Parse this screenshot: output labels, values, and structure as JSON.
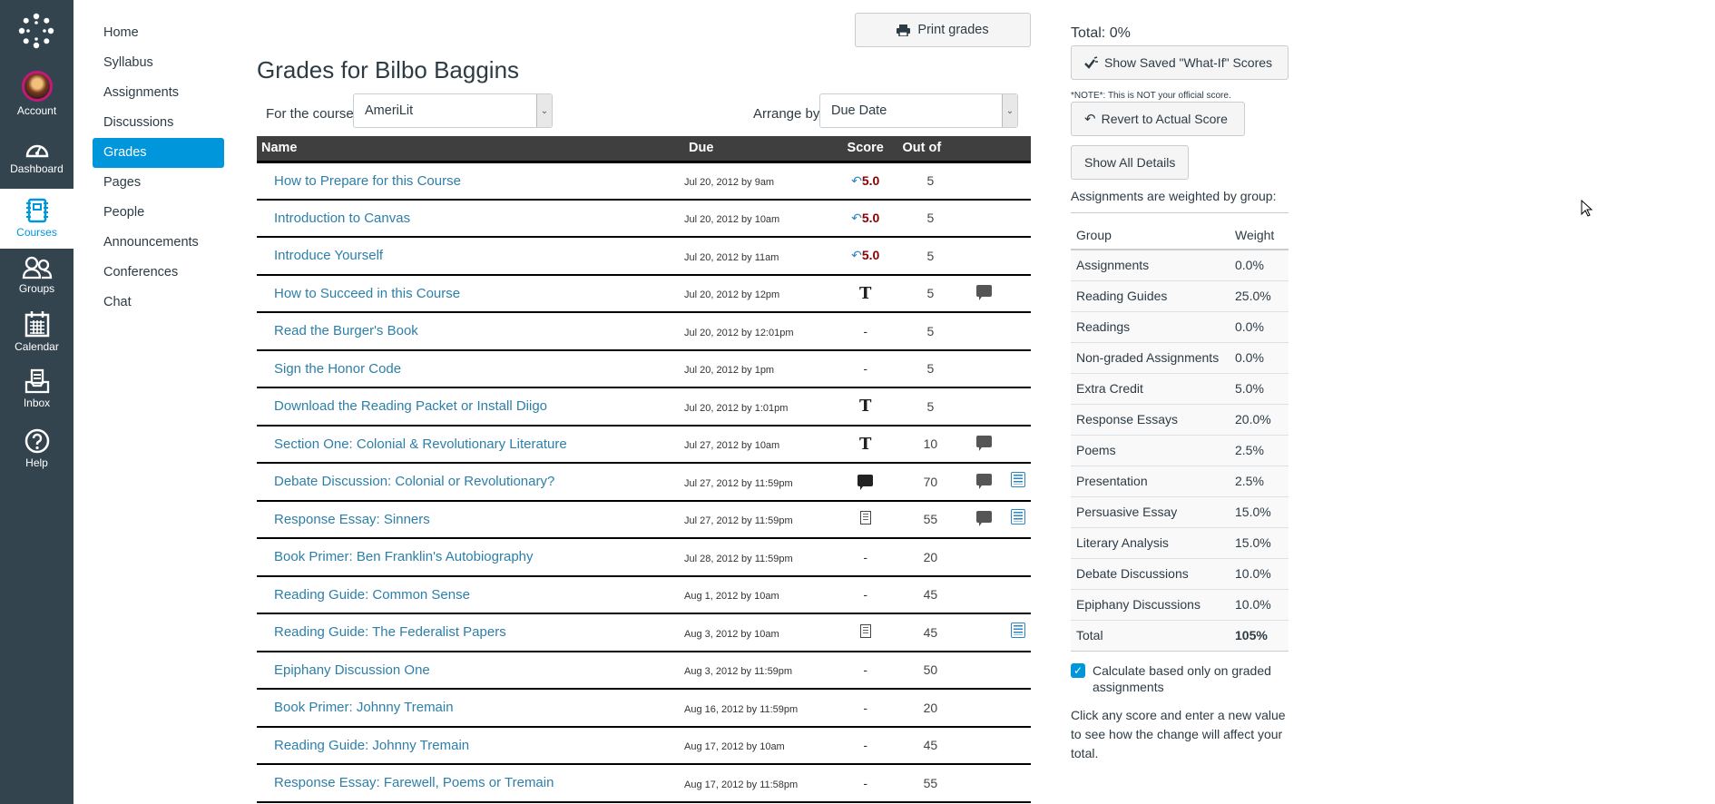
{
  "global_nav": {
    "items": [
      {
        "label": "Account",
        "icon": "avatar"
      },
      {
        "label": "Dashboard",
        "icon": "dashboard-icon"
      },
      {
        "label": "Courses",
        "icon": "courses-icon",
        "active": true
      },
      {
        "label": "Groups",
        "icon": "groups-icon"
      },
      {
        "label": "Calendar",
        "icon": "calendar-icon"
      },
      {
        "label": "Inbox",
        "icon": "inbox-icon"
      },
      {
        "label": "Help",
        "icon": "help-icon"
      }
    ]
  },
  "course_nav": {
    "items": [
      "Home",
      "Syllabus",
      "Assignments",
      "Discussions",
      "Grades",
      "Pages",
      "People",
      "Announcements",
      "Conferences",
      "Chat"
    ],
    "active": "Grades"
  },
  "main": {
    "print_label": "Print grades",
    "title": "Grades for Bilbo Baggins",
    "course_label": "For the course",
    "course_value": "AmeriLit",
    "arrange_label": "Arrange by",
    "arrange_value": "Due Date",
    "columns": {
      "name": "Name",
      "due": "Due",
      "score": "Score",
      "out_of": "Out of"
    },
    "rows": [
      {
        "name": "How to Prepare for this Course",
        "due": "Jul 20, 2012 by 9am",
        "score_type": "whatif",
        "score": "5.0",
        "out_of": "5",
        "comment": false,
        "rubric": false
      },
      {
        "name": "Introduction to Canvas",
        "due": "Jul 20, 2012 by 10am",
        "score_type": "whatif",
        "score": "5.0",
        "out_of": "5",
        "comment": false,
        "rubric": false
      },
      {
        "name": "Introduce Yourself",
        "due": "Jul 20, 2012 by 11am",
        "score_type": "whatif",
        "score": "5.0",
        "out_of": "5",
        "comment": false,
        "rubric": false
      },
      {
        "name": "How to Succeed in this Course",
        "due": "Jul 20, 2012 by 12pm",
        "score_type": "text-entry",
        "score": "",
        "out_of": "5",
        "comment": true,
        "rubric": false
      },
      {
        "name": "Read the Burger's Book",
        "due": "Jul 20, 2012 by 12:01pm",
        "score_type": "none",
        "score": "-",
        "out_of": "5",
        "comment": false,
        "rubric": false
      },
      {
        "name": "Sign the Honor Code",
        "due": "Jul 20, 2012 by 1pm",
        "score_type": "none",
        "score": "-",
        "out_of": "5",
        "comment": false,
        "rubric": false
      },
      {
        "name": "Download the Reading Packet or Install Diigo",
        "due": "Jul 20, 2012 by 1:01pm",
        "score_type": "text-entry",
        "score": "",
        "out_of": "5",
        "comment": false,
        "rubric": false
      },
      {
        "name": "Section One: Colonial & Revolutionary Literature",
        "due": "Jul 27, 2012 by 10am",
        "score_type": "text-entry",
        "score": "",
        "out_of": "10",
        "comment": true,
        "rubric": false
      },
      {
        "name": "Debate Discussion: Colonial or Revolutionary?",
        "due": "Jul 27, 2012 by 11:59pm",
        "score_type": "discussion",
        "score": "",
        "out_of": "70",
        "comment": true,
        "rubric": true
      },
      {
        "name": "Response Essay: Sinners",
        "due": "Jul 27, 2012 by 11:59pm",
        "score_type": "document",
        "score": "",
        "out_of": "55",
        "comment": true,
        "rubric": true
      },
      {
        "name": "Book Primer: Ben Franklin's Autobiography",
        "due": "Jul 28, 2012 by 11:59pm",
        "score_type": "none",
        "score": "-",
        "out_of": "20",
        "comment": false,
        "rubric": false
      },
      {
        "name": "Reading Guide: Common Sense",
        "due": "Aug 1, 2012 by 10am",
        "score_type": "none",
        "score": "-",
        "out_of": "45",
        "comment": false,
        "rubric": false
      },
      {
        "name": "Reading Guide: The Federalist Papers",
        "due": "Aug 3, 2012 by 10am",
        "score_type": "document",
        "score": "",
        "out_of": "45",
        "comment": false,
        "rubric": true
      },
      {
        "name": "Epiphany Discussion One",
        "due": "Aug 3, 2012 by 11:59pm",
        "score_type": "none",
        "score": "-",
        "out_of": "50",
        "comment": false,
        "rubric": false
      },
      {
        "name": "Book Primer: Johnny Tremain",
        "due": "Aug 16, 2012 by 11:59pm",
        "score_type": "none",
        "score": "-",
        "out_of": "20",
        "comment": false,
        "rubric": false
      },
      {
        "name": "Reading Guide: Johnny Tremain",
        "due": "Aug 17, 2012 by 10am",
        "score_type": "none",
        "score": "-",
        "out_of": "45",
        "comment": false,
        "rubric": false
      },
      {
        "name": "Response Essay: Farewell, Poems or Tremain",
        "due": "Aug 17, 2012 by 11:58pm",
        "score_type": "none",
        "score": "-",
        "out_of": "55",
        "comment": false,
        "rubric": false
      }
    ]
  },
  "right_panel": {
    "total": "Total: 0%",
    "show_whatif_label": "Show Saved \"What-If\" Scores",
    "note": "*NOTE*: This is NOT your official score.",
    "revert_label": "Revert to Actual Score",
    "show_details_label": "Show All Details",
    "weighted_text": "Assignments are weighted by group:",
    "weights_header": {
      "group": "Group",
      "weight": "Weight"
    },
    "weights": [
      {
        "group": "Assignments",
        "weight": "0.0%"
      },
      {
        "group": "Reading Guides",
        "weight": "25.0%"
      },
      {
        "group": "Readings",
        "weight": "0.0%"
      },
      {
        "group": "Non-graded Assignments",
        "weight": "0.0%"
      },
      {
        "group": "Extra Credit",
        "weight": "5.0%"
      },
      {
        "group": "Response Essays",
        "weight": "20.0%"
      },
      {
        "group": "Poems",
        "weight": "2.5%"
      },
      {
        "group": "Presentation",
        "weight": "2.5%"
      },
      {
        "group": "Persuasive Essay",
        "weight": "15.0%"
      },
      {
        "group": "Literary Analysis",
        "weight": "15.0%"
      },
      {
        "group": "Debate Discussions",
        "weight": "10.0%"
      },
      {
        "group": "Epiphany Discussions",
        "weight": "10.0%"
      }
    ],
    "weights_total": {
      "group": "Total",
      "weight": "105%"
    },
    "calc_checkbox_checked": true,
    "calc_label": "Calculate based only on graded assignments",
    "help_text": "Click any score and enter a new value to see how the change will affect your total."
  },
  "colors": {
    "nav_bg": "#34444f",
    "accent": "#0096db",
    "link": "#2d7fa8",
    "score_red": "#8b0000",
    "table_header": "#3f3f3f"
  }
}
